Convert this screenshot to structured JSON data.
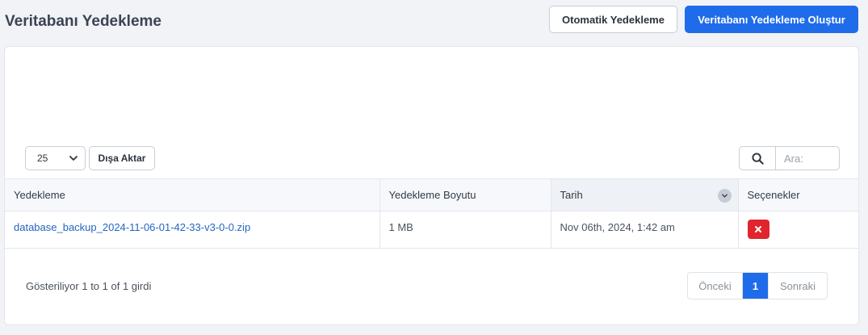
{
  "header": {
    "title": "Veritabanı Yedekleme",
    "auto_backup_label": "Otomatik Yedekleme",
    "create_backup_label": "Veritabanı Yedekleme Oluştur"
  },
  "toolbar": {
    "page_length": "25",
    "export_label": "Dışa Aktar",
    "search_placeholder": "Ara:"
  },
  "table": {
    "columns": [
      "Yedekleme",
      "Yedekleme Boyutu",
      "Tarih",
      "Seçenekler"
    ],
    "rows": [
      {
        "file": "database_backup_2024-11-06-01-42-33-v3-0-0.zip",
        "size": "1 MB",
        "date": "Nov 06th, 2024, 1:42 am"
      }
    ]
  },
  "footer": {
    "info": "Gösteriliyor 1 to 1 of 1 girdi",
    "prev_label": "Önceki",
    "current_page": "1",
    "next_label": "Sonraki"
  },
  "colors": {
    "primary": "#1f6ceb",
    "danger": "#e0252f",
    "link": "#2466c2"
  }
}
